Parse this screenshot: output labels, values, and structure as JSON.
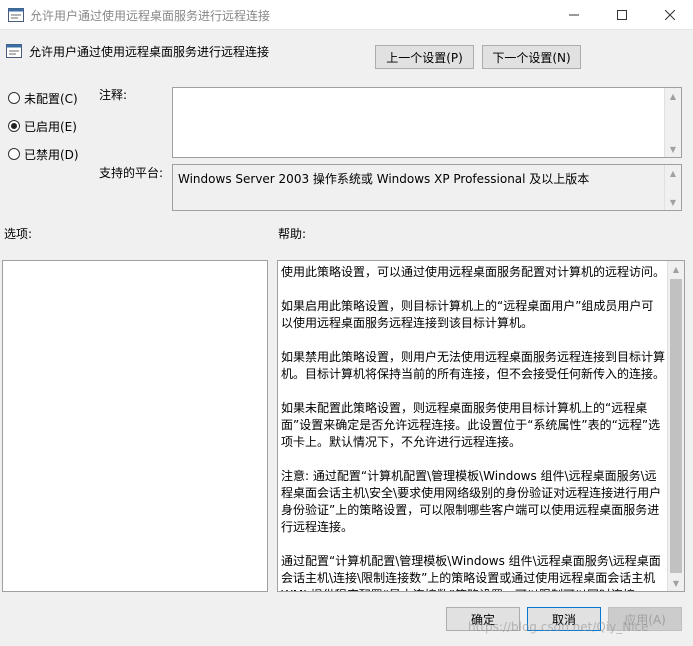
{
  "window": {
    "title": "允许用户通过使用远程桌面服务进行远程连接",
    "controls": {
      "minimize": "—",
      "maximize": "☐",
      "close": "✕"
    }
  },
  "policy": {
    "name": "允许用户通过使用远程桌面服务进行远程连接",
    "prev_label": "上一个设置(P)",
    "next_label": "下一个设置(N)"
  },
  "state": {
    "selected": "enabled",
    "options": [
      {
        "id": "not_configured",
        "label": "未配置(C)"
      },
      {
        "id": "enabled",
        "label": "已启用(E)"
      },
      {
        "id": "disabled",
        "label": "已禁用(D)"
      }
    ]
  },
  "labels": {
    "comment": "注释:",
    "platform": "支持的平台:",
    "options": "选项:",
    "help": "帮助:"
  },
  "comment_value": "",
  "platform_value": "Windows Server 2003 操作系统或 Windows XP Professional 及以上版本",
  "help_paragraphs": [
    "使用此策略设置，可以通过使用远程桌面服务配置对计算机的远程访问。",
    "如果启用此策略设置，则目标计算机上的“远程桌面用户”组成员用户可以使用远程桌面服务远程连接到该目标计算机。",
    "如果禁用此策略设置，则用户无法使用远程桌面服务远程连接到目标计算机。目标计算机将保持当前的所有连接，但不会接受任何新传入的连接。",
    "如果未配置此策略设置，则远程桌面服务使用目标计算机上的“远程桌面”设置来确定是否允许远程连接。此设置位于“系统属性”表的“远程”选项卡上。默认情况下，不允许进行远程连接。",
    "注意: 通过配置“计算机配置\\管理模板\\Windows 组件\\远程桌面服务\\远程桌面会话主机\\安全\\要求使用网络级别的身份验证对远程连接进行用户身份验证”上的策略设置，可以限制哪些客户端可以使用远程桌面服务进行远程连接。",
    "通过配置“计算机配置\\管理模板\\Windows 组件\\远程桌面服务\\远程桌面会话主机\\连接\\限制连接数”上的策略设置或通过使用远程桌面会话主机 WMI 提供程序配置“最大连接数”策略设置，可以限制可以同时连接"
  ],
  "buttons": {
    "ok": "确定",
    "cancel": "取消",
    "apply": "应用(A)"
  },
  "watermark": "https://blog.csdn.net/Qiy_Nice"
}
